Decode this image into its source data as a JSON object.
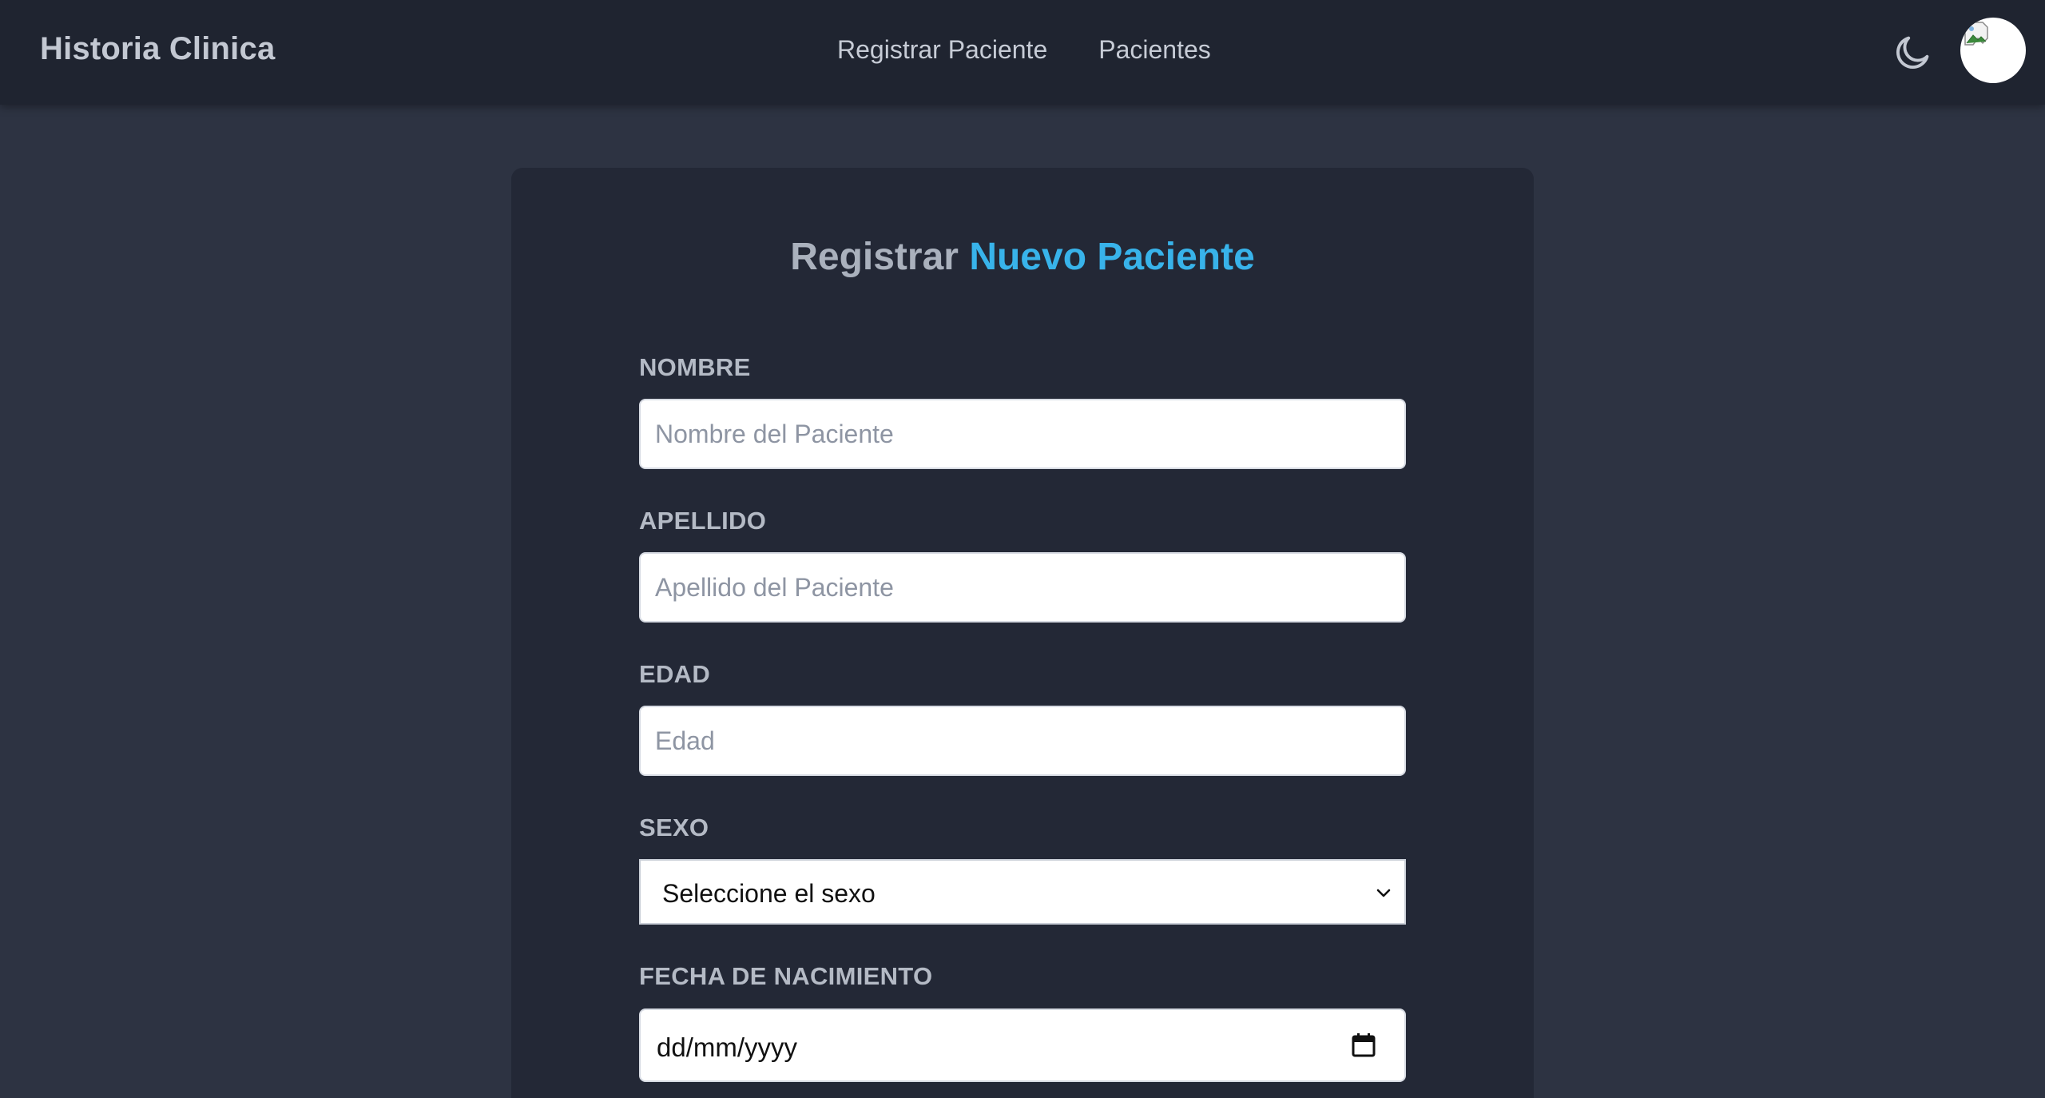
{
  "navbar": {
    "brand": "Historia Clinica",
    "links": [
      "Registrar Paciente",
      "Pacientes"
    ],
    "theme_icon": "moon-icon",
    "avatar_icon": "broken-image-icon"
  },
  "form": {
    "title_prefix": "Registrar",
    "title_accent": "Nuevo Paciente",
    "accent_color": "#38b3ea",
    "nombre": {
      "label": "NOMBRE",
      "placeholder": "Nombre del Paciente",
      "value": ""
    },
    "apellido": {
      "label": "APELLIDO",
      "placeholder": "Apellido del Paciente",
      "value": ""
    },
    "edad": {
      "label": "EDAD",
      "placeholder": "Edad",
      "value": ""
    },
    "sexo": {
      "label": "SEXO",
      "selected": "Seleccione el sexo",
      "icon": "chevron-down-icon"
    },
    "fecha": {
      "label": "FECHA DE NACIMIENTO",
      "value": "dd/mm/yyyy",
      "icon": "calendar-icon"
    }
  }
}
